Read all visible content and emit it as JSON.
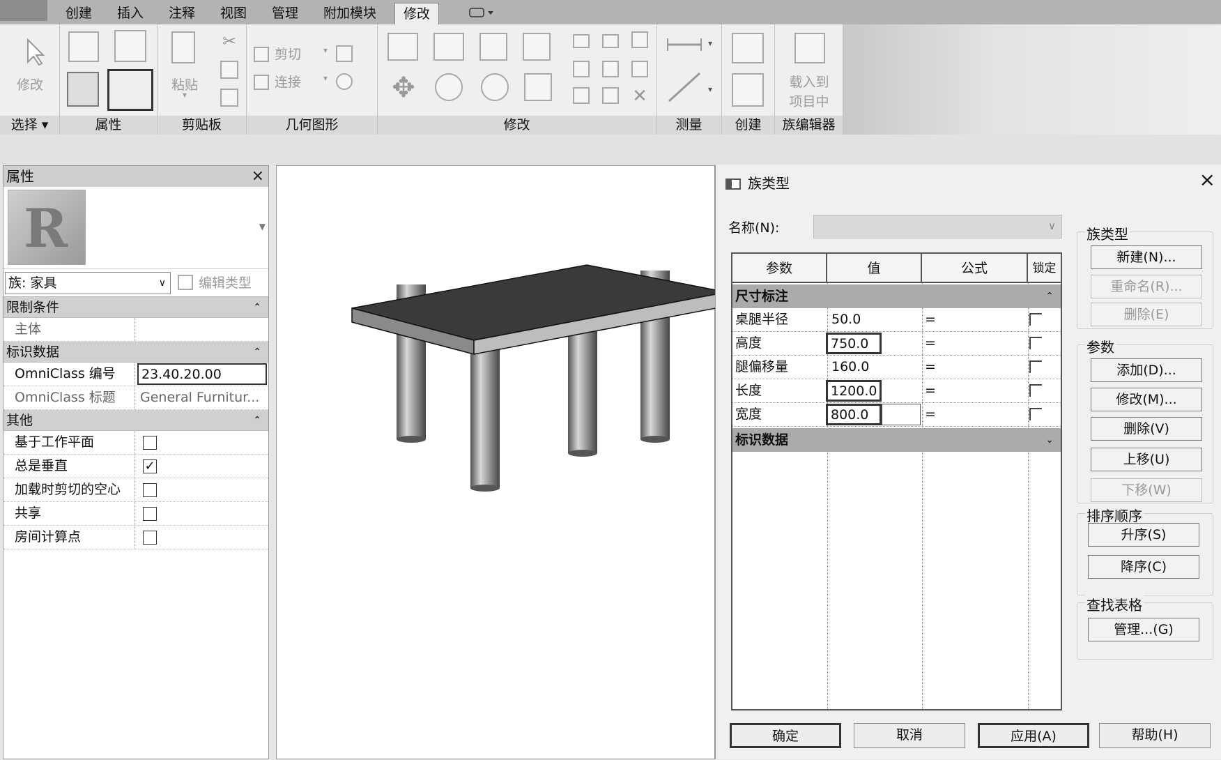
{
  "menu": {
    "tabs": [
      "创建",
      "插入",
      "注释",
      "视图",
      "管理",
      "附加模块",
      "修改"
    ],
    "active_tab": "修改"
  },
  "ribbon": {
    "modify_label": "修改",
    "paste_label": "粘贴",
    "cut_label": "剪切",
    "join_label": "连接",
    "load_label_1": "载入到",
    "load_label_2": "项目中",
    "panels": {
      "select": "选择 ▾",
      "properties": "属性",
      "clipboard": "剪贴板",
      "geometry": "几何图形",
      "modify": "修改",
      "measure": "测量",
      "create": "创建",
      "family_editor": "族编辑器"
    }
  },
  "properties": {
    "title": "属性",
    "close": "×",
    "family_select": "族: 家具",
    "edit_type": "编辑类型",
    "sections": {
      "constraints": "限制条件",
      "identity": "标识数据",
      "other": "其他"
    },
    "host_label": "主体",
    "omniclass_number_label": "OmniClass 编号",
    "omniclass_number_value": "23.40.20.00",
    "omniclass_title_label": "OmniClass 标题",
    "omniclass_title_value": "General Furnitur...",
    "work_plane_label": "基于工作平面",
    "always_vertical_label": "总是垂直",
    "cut_voids_label": "加载时剪切的空心",
    "shared_label": "共享",
    "room_point_label": "房间计算点",
    "always_vertical_checked": true
  },
  "dialog": {
    "title": "族类型",
    "close": "×",
    "name_label": "名称(N):",
    "columns": [
      "参数",
      "值",
      "公式",
      "锁定"
    ],
    "group_dimensions": "尺寸标注",
    "group_identity": "标识数据",
    "rows": [
      {
        "param": "桌腿半径",
        "value": "50.0",
        "formula": "="
      },
      {
        "param": "高度",
        "value": "750.0",
        "formula": "="
      },
      {
        "param": "腿偏移量",
        "value": "160.0",
        "formula": "="
      },
      {
        "param": "长度",
        "value": "1200.0",
        "formula": "="
      },
      {
        "param": "宽度",
        "value": "800.0",
        "formula": "="
      }
    ],
    "family_types_title": "族类型",
    "btn_new": "新建(N)...",
    "btn_rename": "重命名(R)...",
    "btn_delete_type": "删除(E)",
    "params_title": "参数",
    "btn_add": "添加(D)...",
    "btn_modify": "修改(M)...",
    "btn_delete_param": "删除(V)",
    "btn_up": "上移(U)",
    "btn_down": "下移(W)",
    "sort_title": "排序顺序",
    "btn_asc": "升序(S)",
    "btn_desc": "降序(C)",
    "lookup_title": "查找表格",
    "btn_manage": "管理...(G)",
    "btn_ok": "确定",
    "btn_cancel": "取消",
    "btn_apply": "应用(A)",
    "btn_help": "帮助(H)"
  }
}
